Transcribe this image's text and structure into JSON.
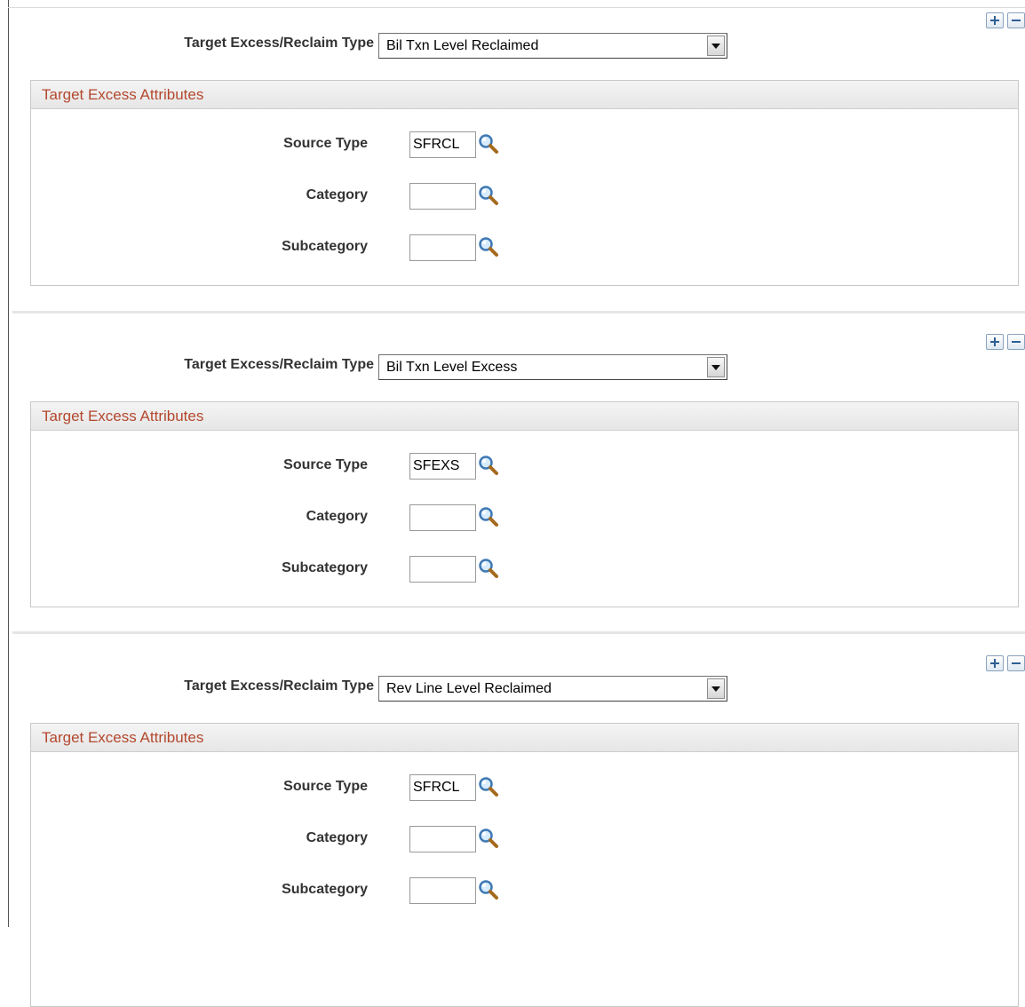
{
  "colors": {
    "group_title": "#b4482e",
    "label": "#333333",
    "row_button_glyph": "#2f5f93"
  },
  "row_buttons": {
    "add_icon": "plus-icon",
    "delete_icon": "minus-icon"
  },
  "lookup_icon": "magnifier-icon",
  "rows": [
    {
      "type_label": "Target Excess/Reclaim Type",
      "type_value": "Bil Txn Level Reclaimed",
      "group_title": "Target Excess Attributes",
      "source_type_label": "Source Type",
      "source_type_value": "SFRCL",
      "category_label": "Category",
      "category_value": "",
      "subcategory_label": "Subcategory",
      "subcategory_value": ""
    },
    {
      "type_label": "Target Excess/Reclaim Type",
      "type_value": "Bil Txn Level Excess",
      "group_title": "Target Excess Attributes",
      "source_type_label": "Source Type",
      "source_type_value": "SFEXS",
      "category_label": "Category",
      "category_value": "",
      "subcategory_label": "Subcategory",
      "subcategory_value": ""
    },
    {
      "type_label": "Target Excess/Reclaim Type",
      "type_value": "Rev Line Level Reclaimed",
      "group_title": "Target Excess Attributes",
      "source_type_label": "Source Type",
      "source_type_value": "SFRCL",
      "category_label": "Category",
      "category_value": "",
      "subcategory_label": "Subcategory",
      "subcategory_value": ""
    }
  ]
}
